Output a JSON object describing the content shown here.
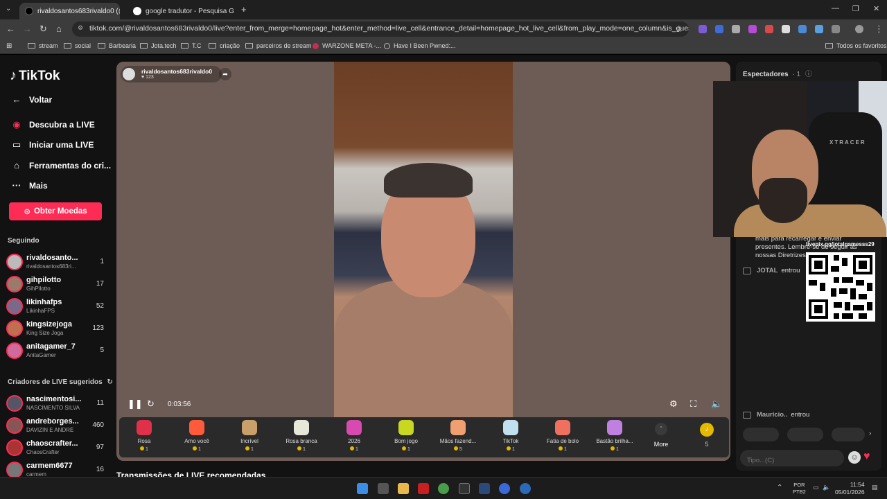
{
  "browser": {
    "tabs": [
      {
        "title": "rivaldosantos683rivaldo0 (@..."
      },
      {
        "title": "google tradutor - Pesquisa Goo..."
      }
    ],
    "url": "tiktok.com/@rivaldosantos683rivaldo0/live?enter_from_merge=homepage_hot&enter_method=live_cell&entrance_detail=homepage_hot_live_cell&from_play_mode=one_column&is_guest_connect=0&...",
    "bookmarks": [
      "stream",
      "social",
      "Barbearia",
      "Jota.tech",
      "T.C",
      "criação",
      "parceiros de stream",
      "WARZONE META -...",
      "Have I Been Pwned:..."
    ],
    "all_bookmarks": "Todos os favoritos"
  },
  "sidebar": {
    "logo": "TikTok",
    "menu": [
      {
        "label": "Voltar",
        "icon": "←"
      },
      {
        "label": "Descubra a LIVE",
        "icon": "◉"
      },
      {
        "label": "Iniciar uma LIVE",
        "icon": "▭"
      },
      {
        "label": "Ferramentas do cri...",
        "icon": "⌂"
      },
      {
        "label": "Mais",
        "icon": "···"
      }
    ],
    "coins_button": "Obter Moedas",
    "following_title": "Seguindo",
    "following": [
      {
        "name": "rivaldosanto...",
        "sub": "rivaldosantos683ri...",
        "count": "1"
      },
      {
        "name": "gihpilotto",
        "sub": "GihPilotto",
        "count": "17"
      },
      {
        "name": "likinhafps",
        "sub": "LikinhaFPS",
        "count": "52"
      },
      {
        "name": "kingsizejoga",
        "sub": "King Size Joga",
        "count": "123"
      },
      {
        "name": "anitagamer_7",
        "sub": "AnitaGamer",
        "count": "5"
      }
    ],
    "suggested_title": "Criadores de LIVE sugeridos",
    "suggested": [
      {
        "name": "nascimentosi...",
        "sub": "NASCIMENTO SILVA",
        "count": "11"
      },
      {
        "name": "andreborges...",
        "sub": "DAVIZIN E ANDRÉ",
        "count": "460"
      },
      {
        "name": "chaoscrafter...",
        "sub": "ChaosCrafter",
        "count": "97"
      },
      {
        "name": "carmem6677",
        "sub": "carmem",
        "count": "16"
      }
    ]
  },
  "player": {
    "host_name": "rivaldosantos683rivaldo0",
    "host_likes": "123",
    "time": "0:03:56"
  },
  "gifts": [
    {
      "name": "Rosa",
      "price": "1",
      "color": "#e0304a"
    },
    {
      "name": "Amo você",
      "price": "1",
      "color": "#ff5a3a"
    },
    {
      "name": "Incrível",
      "price": "1",
      "color": "#c9a06a"
    },
    {
      "name": "Rosa branca",
      "price": "1",
      "color": "#e8e8d8"
    },
    {
      "name": "2026",
      "price": "1",
      "color": "#d84ab0"
    },
    {
      "name": "Bom jogo",
      "price": "1",
      "color": "#c8d820"
    },
    {
      "name": "Mãos fazend...",
      "price": "5",
      "color": "#f0a070"
    },
    {
      "name": "TikTok",
      "price": "1",
      "color": "#c0e0f0"
    },
    {
      "name": "Fatia de bolo",
      "price": "1",
      "color": "#f07060"
    },
    {
      "name": "Bastão brilha...",
      "price": "1",
      "color": "#c080e0"
    }
  ],
  "gift_more": "More",
  "coin_count": "5",
  "recommended_title": "Transmissões de LIVE recomendadas",
  "chat": {
    "spectators_label": "Espectadores",
    "spectators_count": "· 1",
    "system_msg": "mais para recarregar e enviar presentes. Lembre-se de seguir as nossas Diretrizes da Comunidade.",
    "join1_name": "JOTAL",
    "join_text": "entrou",
    "join2_name": "Mauricio..",
    "input_placeholder": "Tipo...(C)"
  },
  "overlay": {
    "qr_label": "livepix.gg/jotalgamesss29",
    "chair_brand": "XTRACER"
  },
  "taskbar": {
    "lang1": "POR",
    "lang2": "PTB2",
    "time": "11:54",
    "date": "05/01/2026"
  }
}
